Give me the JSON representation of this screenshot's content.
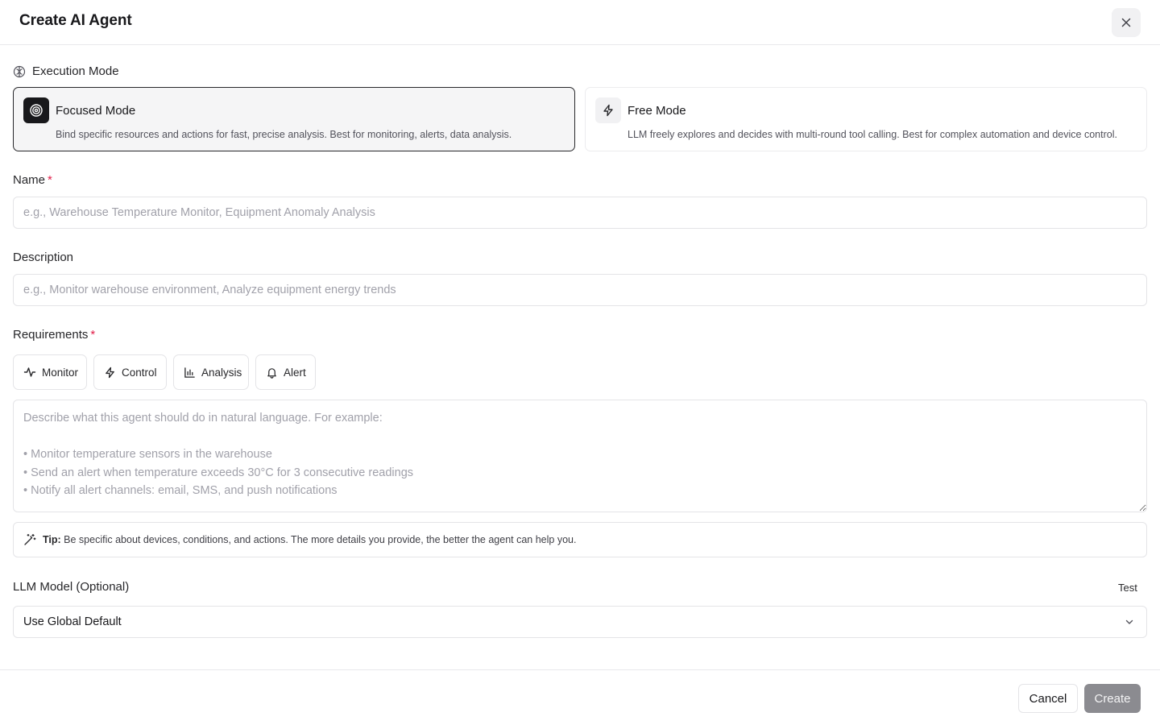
{
  "dialog": {
    "title": "Create AI Agent"
  },
  "execution_mode": {
    "label": "Execution Mode",
    "selected": "focused",
    "options": [
      {
        "id": "focused",
        "title": "Focused Mode",
        "description": "Bind specific resources and actions for fast, precise analysis. Best for monitoring, alerts, data analysis.",
        "icon": "target-icon"
      },
      {
        "id": "free",
        "title": "Free Mode",
        "description": "LLM freely explores and decides with multi-round tool calling. Best for complex automation and device control.",
        "icon": "lightning-icon"
      }
    ]
  },
  "name_field": {
    "label": "Name",
    "required_marker": "*",
    "value": "",
    "placeholder": "e.g., Warehouse Temperature Monitor, Equipment Anomaly Analysis"
  },
  "description_field": {
    "label": "Description",
    "value": "",
    "placeholder": "e.g., Monitor warehouse environment, Analyze equipment energy trends"
  },
  "requirements": {
    "label": "Requirements",
    "required_marker": "*",
    "chips": [
      {
        "label": "Monitor",
        "icon": "activity-icon"
      },
      {
        "label": "Control",
        "icon": "lightning-icon"
      },
      {
        "label": "Analysis",
        "icon": "bar-chart-icon"
      },
      {
        "label": "Alert",
        "icon": "bell-icon"
      }
    ],
    "value": "",
    "placeholder": "Describe what this agent should do in natural language. For example:\n\n• Monitor temperature sensors in the warehouse\n• Send an alert when temperature exceeds 30°C for 3 consecutive readings\n• Notify all alert channels: email, SMS, and push notifications"
  },
  "tip": {
    "prefix": "Tip:",
    "text": "Be specific about devices, conditions, and actions. The more details you provide, the better the agent can help you.",
    "icon": "magic-wand-icon"
  },
  "llm_model": {
    "label": "LLM Model (Optional)",
    "test_label": "Test",
    "selected": "Use Global Default"
  },
  "footer": {
    "cancel_label": "Cancel",
    "create_label": "Create"
  }
}
